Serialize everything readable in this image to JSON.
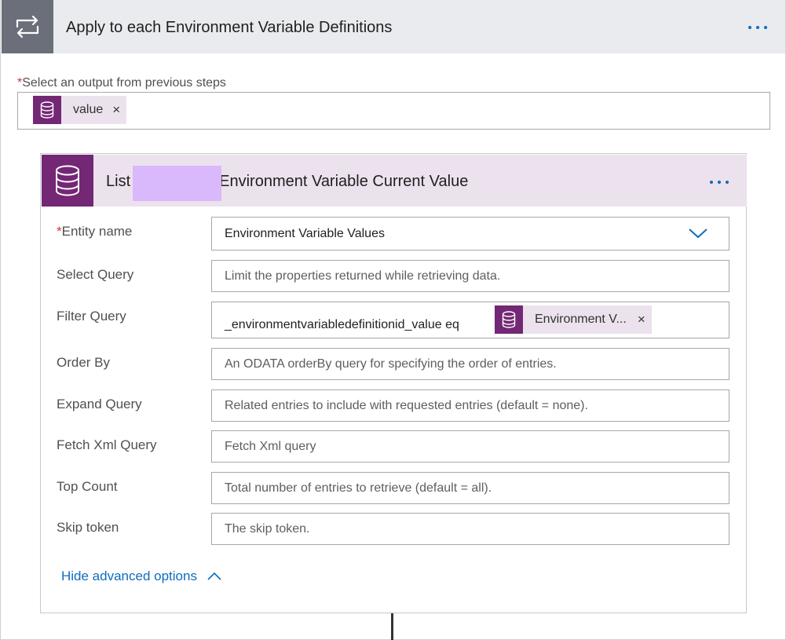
{
  "loop": {
    "title": "Apply to each Environment Variable Definitions",
    "icon": "loop-icon",
    "more_icon": "more-options-icon",
    "output_required": "*",
    "output_label": "Select an output from previous steps",
    "output_token": {
      "label": "value",
      "icon": "database-icon",
      "remove": "×"
    }
  },
  "action": {
    "title_prefix": "List",
    "title_suffix": "Environment Variable Current Value",
    "icon": "database-icon",
    "more_icon": "more-options-icon",
    "fields": {
      "entity_name": {
        "required": "*",
        "label": "Entity name",
        "value": "Environment Variable Values",
        "icon": "chevron-down-icon"
      },
      "select_query": {
        "label": "Select Query",
        "placeholder": "Limit the properties returned while retrieving data."
      },
      "filter_query": {
        "label": "Filter Query",
        "value": "_environmentvariabledefinitionid_value eq",
        "token": {
          "label": "Environment V...",
          "icon": "database-icon",
          "remove": "×"
        }
      },
      "order_by": {
        "label": "Order By",
        "placeholder": "An ODATA orderBy query for specifying the order of entries."
      },
      "expand_query": {
        "label": "Expand Query",
        "placeholder": "Related entries to include with requested entries (default = none)."
      },
      "fetch_xml": {
        "label": "Fetch Xml Query",
        "placeholder": "Fetch Xml query"
      },
      "top_count": {
        "label": "Top Count",
        "placeholder": "Total number of entries to retrieve (default = all)."
      },
      "skip_token": {
        "label": "Skip token",
        "placeholder": "The skip token."
      }
    },
    "hide_advanced": "Hide advanced options"
  },
  "colors": {
    "dataverse_purple": "#742774",
    "token_bg": "#ece2ed",
    "loop_gray": "#6a6f7a",
    "header_gray": "#e9ebee",
    "link_blue": "#0f6cbd",
    "required_red": "#d13438",
    "redaction": "#d9b8fb"
  }
}
